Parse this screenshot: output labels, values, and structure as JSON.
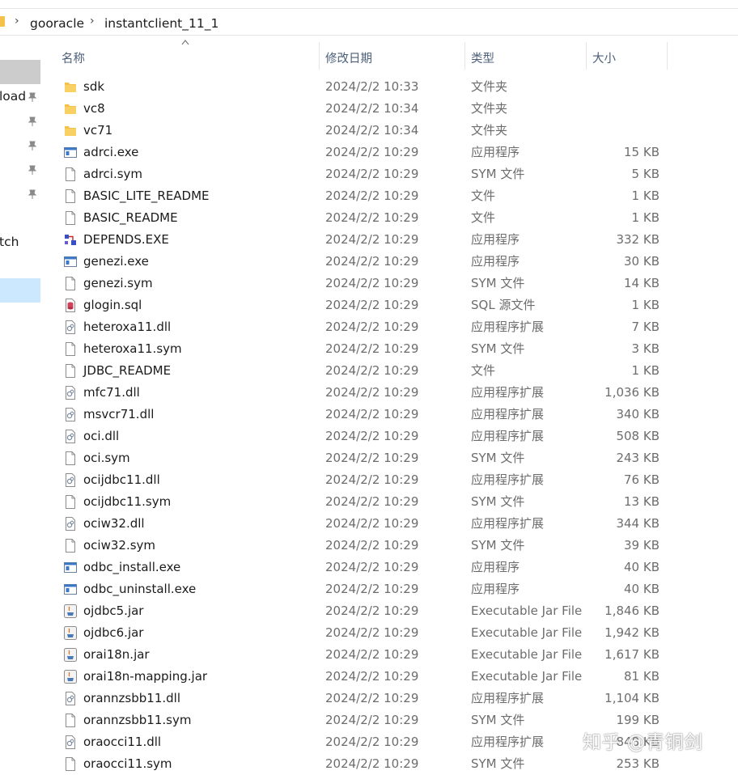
{
  "breadcrumb": {
    "items": [
      "gooracle",
      "instantclient_11_1"
    ]
  },
  "nav": {
    "labels": [
      "load",
      "tch"
    ]
  },
  "columns": {
    "name": "名称",
    "date": "修改日期",
    "type": "类型",
    "size": "大小"
  },
  "files": [
    {
      "name": "sdk",
      "date": "2024/2/2 10:33",
      "type": "文件夹",
      "size": "",
      "icon": "folder-icon"
    },
    {
      "name": "vc8",
      "date": "2024/2/2 10:34",
      "type": "文件夹",
      "size": "",
      "icon": "folder-icon"
    },
    {
      "name": "vc71",
      "date": "2024/2/2 10:34",
      "type": "文件夹",
      "size": "",
      "icon": "folder-icon"
    },
    {
      "name": "adrci.exe",
      "date": "2024/2/2 10:29",
      "type": "应用程序",
      "size": "15 KB",
      "icon": "exe-icon"
    },
    {
      "name": "adrci.sym",
      "date": "2024/2/2 10:29",
      "type": "SYM 文件",
      "size": "5 KB",
      "icon": "file-icon"
    },
    {
      "name": "BASIC_LITE_README",
      "date": "2024/2/2 10:29",
      "type": "文件",
      "size": "1 KB",
      "icon": "file-icon"
    },
    {
      "name": "BASIC_README",
      "date": "2024/2/2 10:29",
      "type": "文件",
      "size": "1 KB",
      "icon": "file-icon"
    },
    {
      "name": "DEPENDS.EXE",
      "date": "2024/2/2 10:29",
      "type": "应用程序",
      "size": "332 KB",
      "icon": "depends-icon"
    },
    {
      "name": "genezi.exe",
      "date": "2024/2/2 10:29",
      "type": "应用程序",
      "size": "30 KB",
      "icon": "exe-icon"
    },
    {
      "name": "genezi.sym",
      "date": "2024/2/2 10:29",
      "type": "SYM 文件",
      "size": "14 KB",
      "icon": "file-icon"
    },
    {
      "name": "glogin.sql",
      "date": "2024/2/2 10:29",
      "type": "SQL 源文件",
      "size": "1 KB",
      "icon": "sql-icon"
    },
    {
      "name": "heteroxa11.dll",
      "date": "2024/2/2 10:29",
      "type": "应用程序扩展",
      "size": "7 KB",
      "icon": "dll-icon"
    },
    {
      "name": "heteroxa11.sym",
      "date": "2024/2/2 10:29",
      "type": "SYM 文件",
      "size": "3 KB",
      "icon": "file-icon"
    },
    {
      "name": "JDBC_README",
      "date": "2024/2/2 10:29",
      "type": "文件",
      "size": "1 KB",
      "icon": "file-icon"
    },
    {
      "name": "mfc71.dll",
      "date": "2024/2/2 10:29",
      "type": "应用程序扩展",
      "size": "1,036 KB",
      "icon": "dll-icon"
    },
    {
      "name": "msvcr71.dll",
      "date": "2024/2/2 10:29",
      "type": "应用程序扩展",
      "size": "340 KB",
      "icon": "dll-icon"
    },
    {
      "name": "oci.dll",
      "date": "2024/2/2 10:29",
      "type": "应用程序扩展",
      "size": "508 KB",
      "icon": "dll-icon"
    },
    {
      "name": "oci.sym",
      "date": "2024/2/2 10:29",
      "type": "SYM 文件",
      "size": "243 KB",
      "icon": "file-icon"
    },
    {
      "name": "ocijdbc11.dll",
      "date": "2024/2/2 10:29",
      "type": "应用程序扩展",
      "size": "76 KB",
      "icon": "dll-icon"
    },
    {
      "name": "ocijdbc11.sym",
      "date": "2024/2/2 10:29",
      "type": "SYM 文件",
      "size": "13 KB",
      "icon": "file-icon"
    },
    {
      "name": "ociw32.dll",
      "date": "2024/2/2 10:29",
      "type": "应用程序扩展",
      "size": "344 KB",
      "icon": "dll-icon"
    },
    {
      "name": "ociw32.sym",
      "date": "2024/2/2 10:29",
      "type": "SYM 文件",
      "size": "39 KB",
      "icon": "file-icon"
    },
    {
      "name": "odbc_install.exe",
      "date": "2024/2/2 10:29",
      "type": "应用程序",
      "size": "40 KB",
      "icon": "exe-icon"
    },
    {
      "name": "odbc_uninstall.exe",
      "date": "2024/2/2 10:29",
      "type": "应用程序",
      "size": "40 KB",
      "icon": "exe-icon"
    },
    {
      "name": "ojdbc5.jar",
      "date": "2024/2/2 10:29",
      "type": "Executable Jar File",
      "size": "1,846 KB",
      "icon": "jar-icon"
    },
    {
      "name": "ojdbc6.jar",
      "date": "2024/2/2 10:29",
      "type": "Executable Jar File",
      "size": "1,942 KB",
      "icon": "jar-icon"
    },
    {
      "name": "orai18n.jar",
      "date": "2024/2/2 10:29",
      "type": "Executable Jar File",
      "size": "1,617 KB",
      "icon": "jar-icon"
    },
    {
      "name": "orai18n-mapping.jar",
      "date": "2024/2/2 10:29",
      "type": "Executable Jar File",
      "size": "81 KB",
      "icon": "jar-icon"
    },
    {
      "name": "orannzsbb11.dll",
      "date": "2024/2/2 10:29",
      "type": "应用程序扩展",
      "size": "1,104 KB",
      "icon": "dll-icon"
    },
    {
      "name": "orannzsbb11.sym",
      "date": "2024/2/2 10:29",
      "type": "SYM 文件",
      "size": "199 KB",
      "icon": "file-icon"
    },
    {
      "name": "oraocci11.dll",
      "date": "2024/2/2 10:29",
      "type": "应用程序扩展",
      "size": "848 KB",
      "icon": "dll-icon"
    },
    {
      "name": "oraocci11.sym",
      "date": "2024/2/2 10:29",
      "type": "SYM 文件",
      "size": "253 KB",
      "icon": "file-icon"
    }
  ],
  "watermark": "知乎 @青铜剑",
  "colors": {
    "folder": "#f4c24a",
    "header_text": "#4c607a",
    "secondary_text": "#6d6d6d",
    "selection": "#cce8ff"
  }
}
